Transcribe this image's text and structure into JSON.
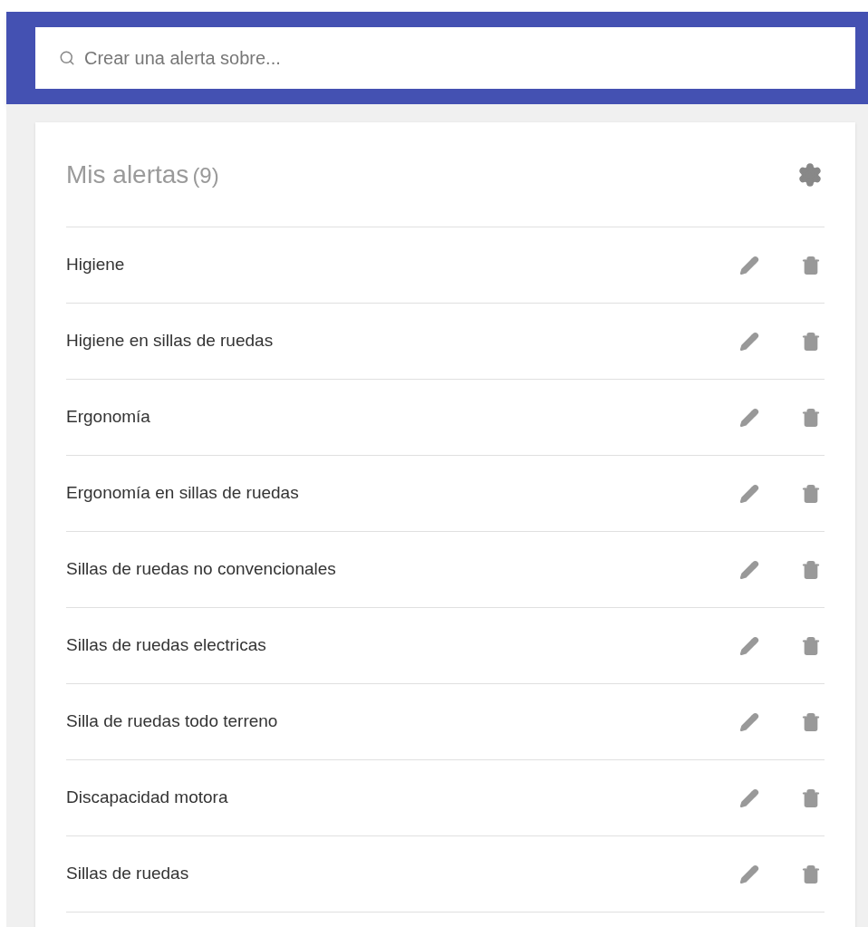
{
  "search": {
    "placeholder": "Crear una alerta sobre..."
  },
  "alerts_panel": {
    "title": "Mis alertas",
    "count": "(9)",
    "items": [
      {
        "label": "Higiene"
      },
      {
        "label": "Higiene en sillas de ruedas"
      },
      {
        "label": "Ergonomía"
      },
      {
        "label": "Ergonomía en sillas de ruedas"
      },
      {
        "label": "Sillas de ruedas no convencionales"
      },
      {
        "label": "Sillas de ruedas electricas"
      },
      {
        "label": "Silla de ruedas todo terreno"
      },
      {
        "label": "Discapacidad motora"
      },
      {
        "label": "Sillas de ruedas"
      }
    ]
  }
}
